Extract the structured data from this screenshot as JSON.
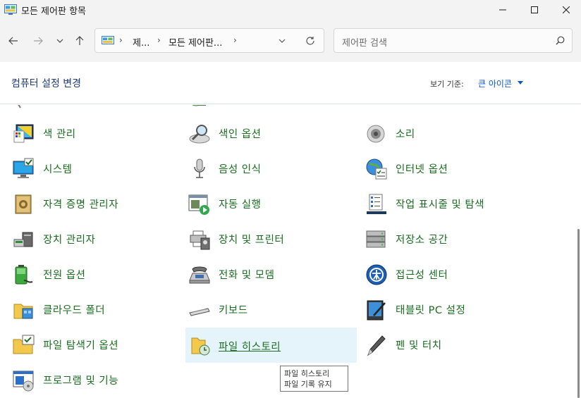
{
  "window": {
    "title": "모든 제어판 항목"
  },
  "address": {
    "crumbs": [
      "제...",
      "모든 제어판..."
    ]
  },
  "search": {
    "placeholder": "제어판 검색"
  },
  "header": {
    "heading": "컴퓨터 설정 변경",
    "view_label": "보기 기준:",
    "view_value": "큰 아이콘"
  },
  "items": {
    "color_management": "색 관리",
    "indexing_options": "색인 옵션",
    "sound": "소리",
    "system": "시스템",
    "speech_recognition": "음성 인식",
    "internet_options": "인터넷 옵션",
    "credential_manager": "자격 증명 관리자",
    "autoplay": "자동 실행",
    "taskbar_navigation": "작업 표시줄 및 탐색",
    "device_manager": "장치 관리자",
    "devices_printers": "장치 및 프린터",
    "storage_spaces": "저장소 공간",
    "power_options": "전원 옵션",
    "phone_modem": "전화 및 모뎀",
    "ease_of_access": "접근성 센터",
    "work_folders": "클라우드 폴더",
    "keyboard": "키보드",
    "tablet_pc": "태블릿 PC 설정",
    "file_explorer_options": "파일 탐색기 옵션",
    "file_history": "파일 히스토리",
    "pen_touch": "펜 및 터치",
    "programs_features": "프로그램 및 기능"
  },
  "tooltip": {
    "line1": "파일 히스토리",
    "line2": "파일 기록 유지"
  },
  "colors": {
    "link_green": "#1a6e1f",
    "heading_blue": "#1e3a78",
    "accent_blue": "#0a57c7",
    "hover_bg": "#e5f3fb"
  }
}
